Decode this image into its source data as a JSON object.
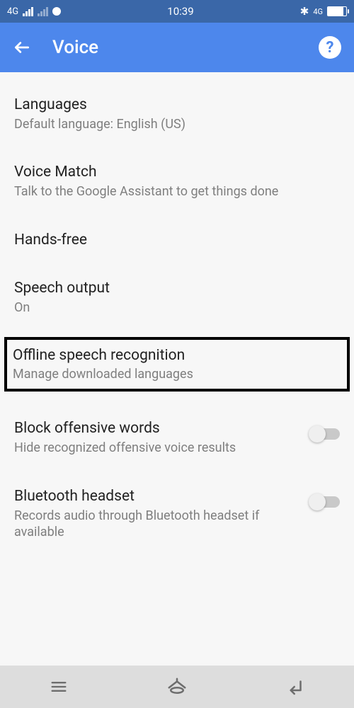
{
  "statusbar": {
    "net": "4G",
    "time": "10:39",
    "rnet": "4G"
  },
  "header": {
    "title": "Voice"
  },
  "items": {
    "languages": {
      "title": "Languages",
      "sub": "Default language: English (US)"
    },
    "voicematch": {
      "title": "Voice Match",
      "sub": "Talk to the Google Assistant to get things done"
    },
    "handsfree": {
      "title": "Hands-free"
    },
    "speechoutput": {
      "title": "Speech output",
      "sub": "On"
    },
    "offline": {
      "title": "Offline speech recognition",
      "sub": "Manage downloaded languages"
    },
    "block": {
      "title": "Block offensive words",
      "sub": "Hide recognized offensive voice results"
    },
    "bt": {
      "title": "Bluetooth headset",
      "sub": "Records audio through Bluetooth headset if available"
    }
  }
}
